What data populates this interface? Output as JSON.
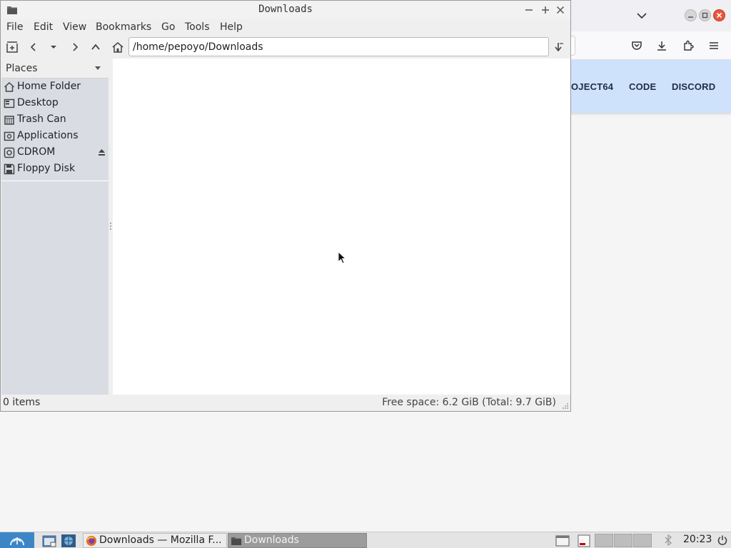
{
  "firefox": {
    "site_nav": {
      "partial": "OJECT64",
      "code": "CODE",
      "discord": "DISCORD"
    },
    "icons": [
      "list-tabs-icon",
      "minimize-icon",
      "maximize-icon",
      "close-icon",
      "pocket-icon",
      "download-icon",
      "extensions-icon",
      "hamburger-menu-icon"
    ]
  },
  "filemanager": {
    "title": "Downloads",
    "menu": {
      "file": "File",
      "edit": "Edit",
      "view": "View",
      "bookmarks": "Bookmarks",
      "go": "Go",
      "tools": "Tools",
      "help": "Help"
    },
    "path": "/home/pepoyo/Downloads",
    "sidebar": {
      "header": "Places",
      "items": [
        {
          "label": "Home Folder",
          "icon": "home-icon"
        },
        {
          "label": "Desktop",
          "icon": "desktop-icon"
        },
        {
          "label": "Trash Can",
          "icon": "trash-icon"
        },
        {
          "label": "Applications",
          "icon": "applications-icon"
        },
        {
          "label": "CDROM",
          "icon": "cdrom-icon"
        },
        {
          "label": "Floppy Disk",
          "icon": "floppy-icon"
        }
      ]
    },
    "status": {
      "items": "0 items",
      "free_space": "Free space: 6.2 GiB (Total: 9.7 GiB)"
    }
  },
  "taskbar": {
    "tasks": [
      {
        "label": "Downloads — Mozilla F...",
        "icon": "firefox-icon"
      },
      {
        "label": "Downloads",
        "icon": "folder-icon"
      }
    ],
    "clock": "20:23"
  },
  "colors": {
    "site_bar": "#cfe2fb",
    "menu_button": "#3c86c8",
    "ff_close": "#e9553c",
    "sidebar": "#d9dde3"
  }
}
